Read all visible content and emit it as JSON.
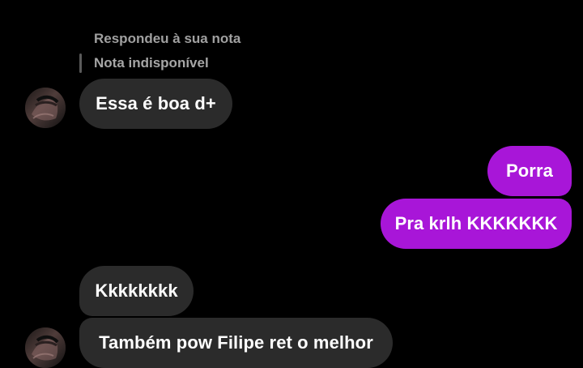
{
  "conversation": {
    "reply": {
      "status": "Respondeu à sua nota",
      "unavailable_note": "Nota indisponível"
    },
    "messages": [
      {
        "text": "Essa é boa d+",
        "sender": "contact"
      },
      {
        "text": "Porra",
        "sender": "me"
      },
      {
        "text": "Pra krlh KKKKKKK",
        "sender": "me"
      },
      {
        "text": "Kkkkkkkk",
        "sender": "contact"
      },
      {
        "text": "Também pow Filipe ret o melhor",
        "sender": "contact"
      }
    ]
  },
  "colors": {
    "background": "#000000",
    "received_bubble": "#2b2b2b",
    "sent_bubble": "#a816d8",
    "secondary_text": "#a0a0a0"
  },
  "icons": {
    "avatar": "avatar"
  }
}
